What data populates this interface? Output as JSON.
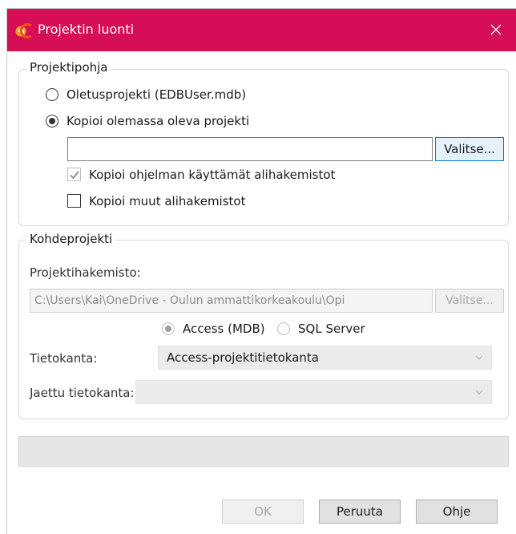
{
  "window": {
    "title": "Projektin luonti",
    "icon": "ec-logo-icon",
    "accent_color": "#d50e55"
  },
  "template_group": {
    "legend": "Projektipohja",
    "radio_default_label": "Oletusprojekti (EDBUser.mdb)",
    "radio_default_checked": false,
    "radio_copy_label": "Kopioi olemassa oleva projekti",
    "radio_copy_checked": true,
    "source_path_value": "",
    "browse_label": "Valitse...",
    "copy_used_subdirs_label": "Kopioi ohjelman käyttämät alihakemistot",
    "copy_used_subdirs_checked": true,
    "copy_other_subdirs_label": "Kopioi muut alihakemistot",
    "copy_other_subdirs_checked": false
  },
  "target_group": {
    "legend": "Kohdeprojekti",
    "dir_label": "Projektihakemisto:",
    "dir_value": "C:\\Users\\Kai\\OneDrive - Oulun ammattikorkeakoulu\\Opi",
    "browse_label": "Valitse...",
    "db_type_access_label": "Access (MDB)",
    "db_type_access_checked": true,
    "db_type_sql_label": "SQL Server",
    "db_type_sql_checked": false,
    "database_label": "Tietokanta:",
    "database_value": "Access-projektitietokanta",
    "shared_db_label": "Jaettu tietokanta:",
    "shared_db_value": ""
  },
  "buttons": {
    "ok_label": "OK",
    "cancel_label": "Peruuta",
    "help_label": "Ohje"
  }
}
